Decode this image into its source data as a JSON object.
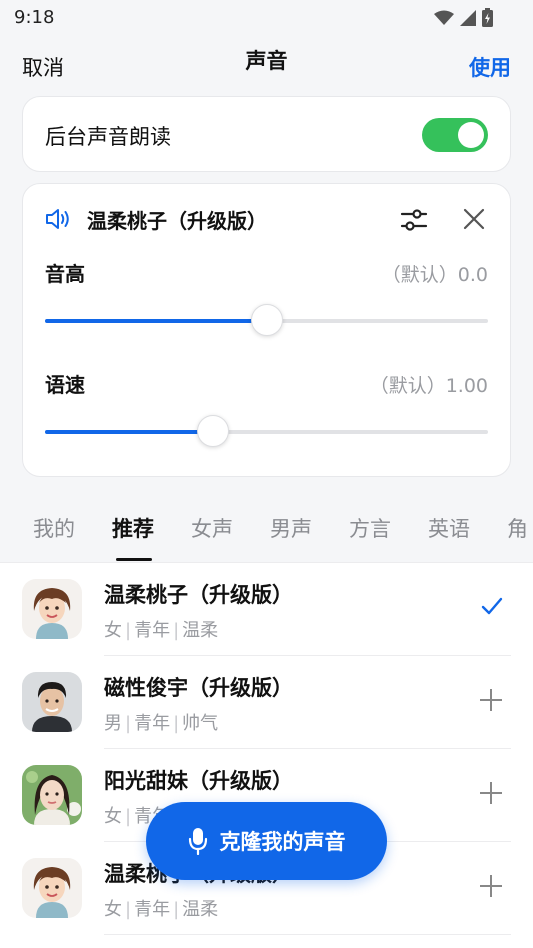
{
  "status": {
    "time": "9:18"
  },
  "nav": {
    "cancel": "取消",
    "title": "声音",
    "use": "使用"
  },
  "background_read": {
    "label": "后台声音朗读",
    "enabled": true
  },
  "voice_card": {
    "name": "温柔桃子（升级版）",
    "pitch": {
      "label": "音高",
      "value_text": "（默认）0.0",
      "level": 0.5
    },
    "speed": {
      "label": "语速",
      "value_text": "（默认）1.00",
      "level": 0.38
    }
  },
  "tabs": [
    "我的",
    "推荐",
    "女声",
    "男声",
    "方言",
    "英语",
    "角"
  ],
  "active_tab": "推荐",
  "voices": [
    {
      "name": "温柔桃子（升级版）",
      "tags": [
        "女",
        "青年",
        "温柔"
      ],
      "selected": true,
      "avatar": "cartoon-woman"
    },
    {
      "name": "磁性俊宇（升级版）",
      "tags": [
        "男",
        "青年",
        "帅气"
      ],
      "selected": false,
      "avatar": "man-photo"
    },
    {
      "name": "阳光甜妹（升级版）",
      "tags": [
        "女",
        "青年",
        ""
      ],
      "selected": false,
      "avatar": "woman-photo"
    },
    {
      "name": "温柔桃子（升级版）",
      "tags": [
        "女",
        "青年",
        "温柔"
      ],
      "selected": false,
      "avatar": "cartoon-woman"
    }
  ],
  "clone_button": {
    "label": "克隆我的声音",
    "icon": "microphone-icon"
  },
  "colors": {
    "accent": "#1167e8",
    "toggle_on": "#35c15b"
  }
}
